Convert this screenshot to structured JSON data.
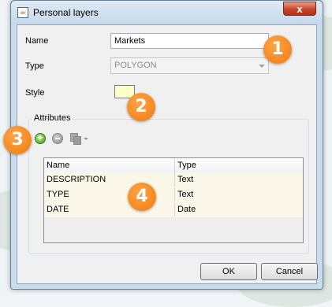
{
  "window": {
    "title": "Personal layers",
    "close_symbol": "x"
  },
  "form": {
    "name_label": "Name",
    "name_value": "Markets",
    "type_label": "Type",
    "type_value": "POLYGON",
    "style_label": "Style",
    "style_fill_color": "#ffffc8"
  },
  "attributes": {
    "group_label": "Attributes",
    "toolbar": {
      "add_icon": "add-icon",
      "remove_icon": "remove-icon",
      "copy_icon": "copy-icon"
    },
    "columns": [
      "Name",
      "Type"
    ],
    "rows": [
      {
        "name": "DESCRIPTION",
        "type": "Text"
      },
      {
        "name": "TYPE",
        "type": "Text"
      },
      {
        "name": "DATE",
        "type": "Date"
      }
    ]
  },
  "buttons": {
    "ok": "OK",
    "cancel": "Cancel"
  },
  "callouts": [
    "1",
    "2",
    "3",
    "4"
  ],
  "colors": {
    "callout": "#f07b0e",
    "row_bg": "#fbf7e8",
    "close_button": "#c7442a"
  }
}
